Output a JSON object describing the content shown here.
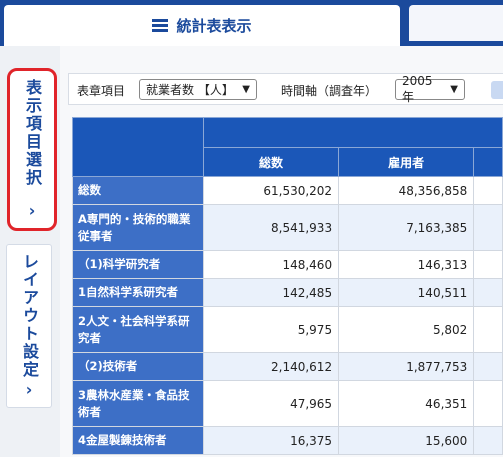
{
  "tabs": {
    "active_label": "統計表表示"
  },
  "side_tabs": [
    {
      "label": "表示項目選択",
      "chevron": "›"
    },
    {
      "label": "レイアウト設定",
      "chevron": "›"
    }
  ],
  "toolbar": {
    "item_label": "表章項目",
    "item_value": "就業者数 【人】",
    "time_label": "時間軸（調査年）",
    "time_value": "2005年"
  },
  "table": {
    "columns": [
      "総数",
      "雇用者"
    ],
    "rows": [
      {
        "label": "総数",
        "values": [
          "61,530,202",
          "48,356,858"
        ]
      },
      {
        "label": "A専門的・技術的職業従事者",
        "values": [
          "8,541,933",
          "7,163,385"
        ]
      },
      {
        "label": "（1)科学研究者",
        "values": [
          "148,460",
          "146,313"
        ]
      },
      {
        "label": "1自然科学系研究者",
        "values": [
          "142,485",
          "140,511"
        ]
      },
      {
        "label": "2人文・社会科学系研究者",
        "values": [
          "5,975",
          "5,802"
        ]
      },
      {
        "label": "（2)技術者",
        "values": [
          "2,140,612",
          "1,877,753"
        ]
      },
      {
        "label": "3農林水産業・食品技術者",
        "values": [
          "47,965",
          "46,351"
        ]
      },
      {
        "label": "4金屋製錬技術者",
        "values": [
          "16,375",
          "15,600"
        ]
      }
    ]
  }
}
